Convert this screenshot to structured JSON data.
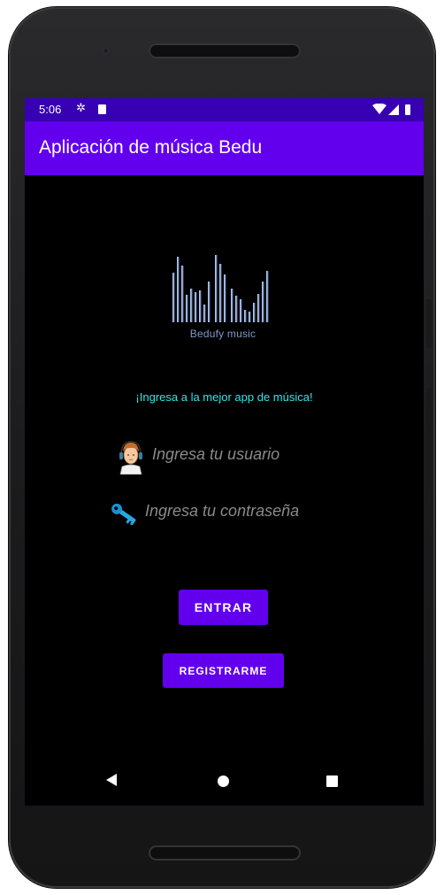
{
  "status_bar": {
    "time": "5:06",
    "icons": [
      "gear-icon",
      "sd-card-icon",
      "wifi-icon",
      "signal-icon",
      "battery-icon"
    ]
  },
  "app_bar": {
    "title": "Aplicación de música Bedu",
    "color": "#6200ee"
  },
  "logo": {
    "text": "Bedufy music"
  },
  "tagline": "¡Ingresa a la mejor app de música!",
  "username_field": {
    "placeholder": "Ingresa tu usuario",
    "value": "",
    "icon": "user-avatar-icon"
  },
  "password_field": {
    "placeholder": "Ingresa tu contraseña",
    "value": "",
    "icon": "key-icon"
  },
  "buttons": {
    "enter_label": "ENTRAR",
    "register_label": "REGISTRARME"
  },
  "nav_bar": {
    "icons": [
      "back-icon",
      "home-icon",
      "recents-icon"
    ]
  },
  "colors": {
    "status_bar": "#3700b3",
    "accent": "#6200ee",
    "tagline": "#2ee6e6",
    "background": "#000000"
  }
}
